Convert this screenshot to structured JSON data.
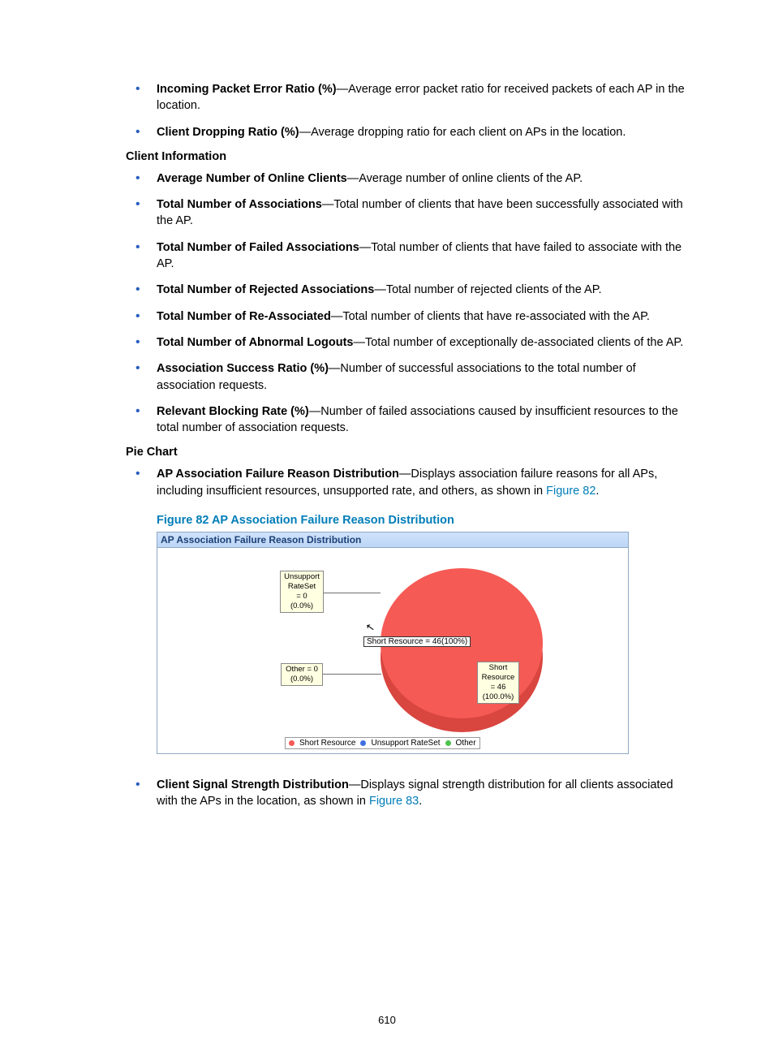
{
  "list1": [
    {
      "term": "Incoming Packet Error Ratio (%)",
      "desc": "—Average error packet ratio for received packets of each AP in the location."
    },
    {
      "term": "Client Dropping Ratio (%)",
      "desc": "—Average dropping ratio for each client on APs in the location."
    }
  ],
  "heading2": "Client Information",
  "list2": [
    {
      "term": "Average Number of Online Clients",
      "desc": "—Average number of online clients of the AP."
    },
    {
      "term": "Total Number of Associations",
      "desc": "—Total number of clients that have been successfully associated with the AP."
    },
    {
      "term": "Total Number of Failed Associations",
      "desc": "—Total number of clients that have failed to associate with the AP."
    },
    {
      "term": "Total Number of Rejected Associations",
      "desc": "—Total number of rejected clients of the AP."
    },
    {
      "term": "Total Number of Re-Associated",
      "desc": "—Total number of clients that have re-associated with the AP."
    },
    {
      "term": "Total Number of Abnormal Logouts",
      "desc": "—Total number of exceptionally de-associated clients of the AP."
    },
    {
      "term": "Association Success Ratio (%)",
      "desc": "—Number of successful associations to the total number of association requests."
    },
    {
      "term": "Relevant Blocking Rate (%)",
      "desc": "—Number of failed associations caused by insufficient resources to the total number of association requests."
    }
  ],
  "heading3": "Pie Chart",
  "pie_item": {
    "term": "AP Association Failure Reason Distribution",
    "desc1": "—Displays association failure reasons for all APs, including insufficient resources, unsupported rate, and others, as shown in ",
    "link": "Figure 82",
    "desc2": "."
  },
  "figure_caption": "Figure 82 AP Association Failure Reason Distribution",
  "panel_title": "AP Association Failure Reason Distribution",
  "chart_data": {
    "type": "pie",
    "title": "AP Association Failure Reason Distribution",
    "series": [
      {
        "name": "Short Resource",
        "value": 46,
        "percent": 100.0,
        "color": "#f55a55"
      },
      {
        "name": "Unsupport RateSet",
        "value": 0,
        "percent": 0.0,
        "color": "#3e6fe0"
      },
      {
        "name": "Other",
        "value": 0,
        "percent": 0.0,
        "color": "#4fc24f"
      }
    ],
    "tooltip": "Short Resource = 46(100%)",
    "label_unsupport": "Unsupport\nRateSet\n= 0\n(0.0%)",
    "label_other": "Other = 0\n(0.0%)",
    "label_short": "Short\nResource\n= 46\n(100.0%)"
  },
  "legend": {
    "items": [
      "Short Resource",
      "Unsupport RateSet",
      "Other"
    ],
    "colors": [
      "#f55a55",
      "#3e6fe0",
      "#4fc24f"
    ]
  },
  "post_item": {
    "term": "Client Signal Strength Distribution",
    "desc1": "—Displays signal strength distribution for all clients associated with the APs in the location, as shown in ",
    "link": "Figure 83",
    "desc2": "."
  },
  "page_number": "610"
}
